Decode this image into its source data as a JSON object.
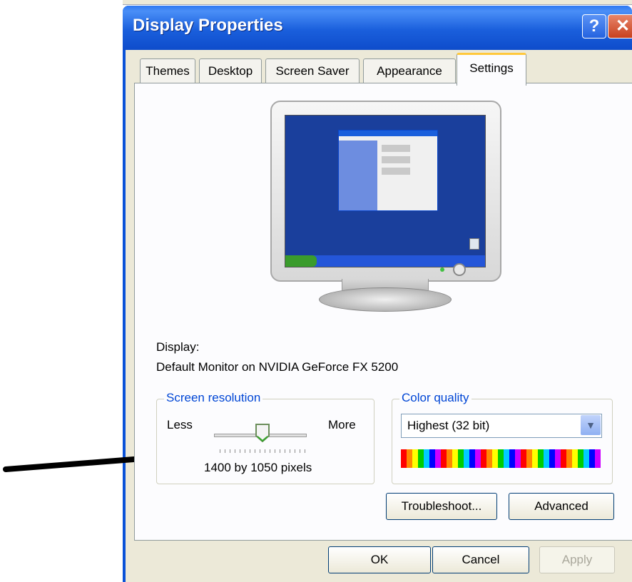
{
  "window": {
    "title": "Display Properties",
    "help_label": "?",
    "close_label": "✕"
  },
  "tabs": [
    {
      "label": "Themes"
    },
    {
      "label": "Desktop"
    },
    {
      "label": "Screen Saver"
    },
    {
      "label": "Appearance"
    },
    {
      "label": "Settings"
    }
  ],
  "active_tab": "Settings",
  "display": {
    "label": "Display:",
    "value": "Default Monitor on NVIDIA GeForce FX 5200"
  },
  "resolution": {
    "legend": "Screen resolution",
    "less": "Less",
    "more": "More",
    "value_text": "1400 by 1050 pixels"
  },
  "color_quality": {
    "legend": "Color quality",
    "selected": "Highest (32 bit)"
  },
  "buttons": {
    "troubleshoot": "Troubleshoot...",
    "advanced": "Advanced",
    "ok": "OK",
    "cancel": "Cancel",
    "apply": "Apply"
  },
  "colors": {
    "title_bar": "#0a52d8",
    "legend_text": "#0046d5",
    "active_tab_accent": "#ffc83c"
  }
}
